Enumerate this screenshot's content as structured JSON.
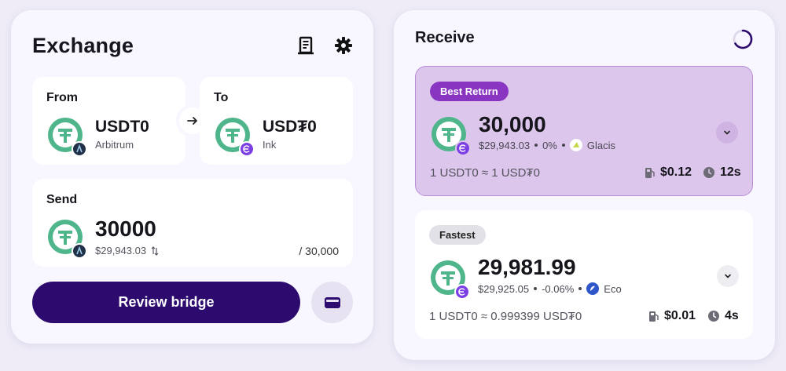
{
  "exchange": {
    "title": "Exchange",
    "from": {
      "label": "From",
      "symbol": "USDT0",
      "chain": "Arbitrum"
    },
    "to": {
      "label": "To",
      "symbol": "USD₮0",
      "chain": "Ink"
    },
    "send": {
      "label": "Send",
      "amount": "30000",
      "usd_value": "$29,943.03",
      "max": "/ 30,000"
    },
    "review_label": "Review bridge"
  },
  "receive": {
    "title": "Receive",
    "routes": [
      {
        "badge": "Best Return",
        "amount": "30,000",
        "usd_value": "$29,943.03",
        "change": "0%",
        "provider": "Glacis",
        "rate": "1 USDT0 ≈ 1 USD₮0",
        "gas": "$0.12",
        "time": "12s"
      },
      {
        "badge": "Fastest",
        "amount": "29,981.99",
        "usd_value": "$29,925.05",
        "change": "-0.06%",
        "provider": "Eco",
        "rate": "1 USDT0 ≈ 0.999399 USD₮0",
        "gas": "$0.01",
        "time": "4s"
      }
    ]
  },
  "colors": {
    "accent": "#2c0a6e",
    "token_green": "#4fb58a",
    "best_bg": "#dcc6ec",
    "best_badge": "#8a35c2"
  },
  "icons": {
    "history": "receipt-icon",
    "settings": "gear-icon",
    "swap": "arrow-right-icon",
    "wallet": "wallet-icon",
    "gas": "gas-pump-icon",
    "time": "clock-icon",
    "expand": "chevron-down-icon"
  }
}
